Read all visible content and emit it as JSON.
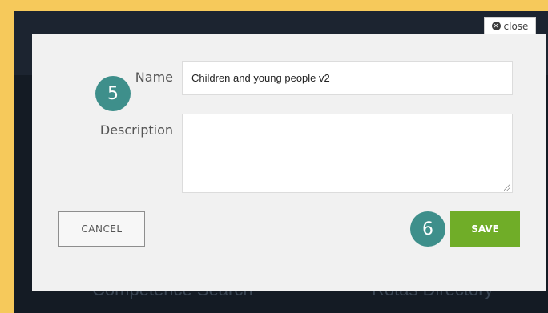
{
  "background": {
    "left_label": "Competence Search",
    "right_label": "Rotas Directory"
  },
  "close_tab": {
    "label": "close",
    "icon": "close-circle-icon"
  },
  "dialog": {
    "name_label": "Name",
    "name_value": "Children and young people v2",
    "description_label": "Description",
    "description_value": "",
    "cancel_label": "CANCEL",
    "save_label": "SAVE"
  },
  "badges": {
    "step_a": "5",
    "step_b": "6"
  },
  "colors": {
    "frame": "#f6c95b",
    "save_button": "#70ad28",
    "badge": "#3e8f8b"
  }
}
